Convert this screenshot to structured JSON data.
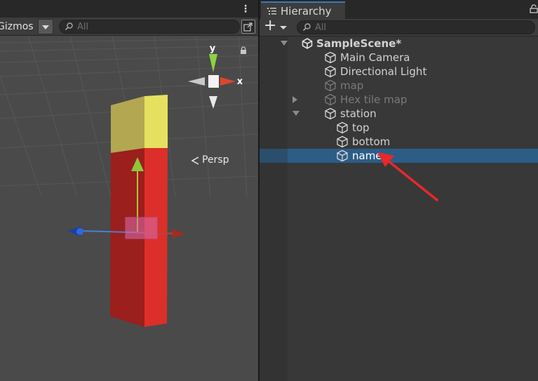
{
  "scene_view": {
    "toolbar": {
      "gizmos_label": "Gizmos",
      "search_placeholder": "All"
    },
    "orientation_gizmo": {
      "y_label": "y",
      "x_label": "x",
      "projection_label": "Persp"
    }
  },
  "hierarchy": {
    "tab_label": "Hierarchy",
    "search_placeholder": "All",
    "items": [
      {
        "label": "SampleScene*",
        "icon": "unity-scene-icon",
        "depth": 0,
        "foldout": "open",
        "bold": true,
        "dim": false,
        "selected": false
      },
      {
        "label": "Main Camera",
        "icon": "gameobject-cube-icon",
        "depth": 1,
        "foldout": "none",
        "bold": false,
        "dim": false,
        "selected": false
      },
      {
        "label": "Directional Light",
        "icon": "gameobject-cube-icon",
        "depth": 1,
        "foldout": "none",
        "bold": false,
        "dim": false,
        "selected": false
      },
      {
        "label": "map",
        "icon": "gameobject-cube-icon",
        "depth": 1,
        "foldout": "none",
        "bold": false,
        "dim": true,
        "selected": false
      },
      {
        "label": "Hex tile map",
        "icon": "gameobject-cube-icon",
        "depth": 1,
        "foldout": "closed",
        "bold": false,
        "dim": true,
        "selected": false
      },
      {
        "label": "station",
        "icon": "gameobject-cube-icon",
        "depth": 1,
        "foldout": "open",
        "bold": false,
        "dim": false,
        "selected": false
      },
      {
        "label": "top",
        "icon": "gameobject-cube-icon",
        "depth": 2,
        "foldout": "none",
        "bold": false,
        "dim": false,
        "selected": false
      },
      {
        "label": "bottom",
        "icon": "gameobject-cube-icon",
        "depth": 2,
        "foldout": "none",
        "bold": false,
        "dim": false,
        "selected": false
      },
      {
        "label": "name",
        "icon": "gameobject-cube-icon",
        "depth": 2,
        "foldout": "none",
        "bold": false,
        "dim": false,
        "selected": true
      }
    ]
  },
  "colors": {
    "selection": "#2c5d87",
    "tab_accent": "#3a79bb",
    "annotation_arrow": "#e8282a",
    "block_top": "#e6e060",
    "block_bottom": "#e02f2a"
  }
}
